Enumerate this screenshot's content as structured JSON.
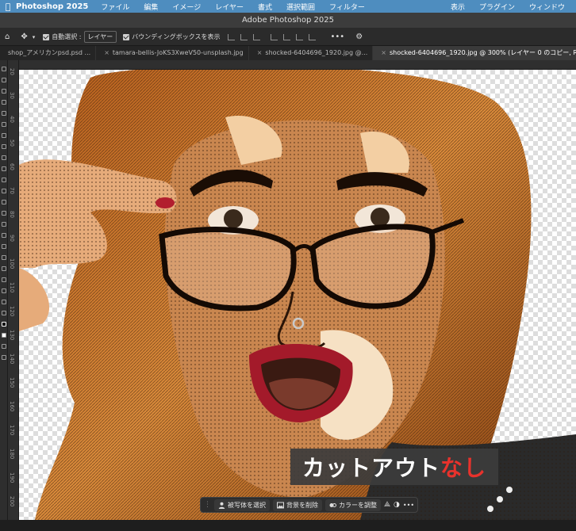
{
  "menubar": {
    "app": "Photoshop 2025",
    "items": [
      "ファイル",
      "編集",
      "イメージ",
      "レイヤー",
      "書式",
      "選択範囲",
      "フィルター"
    ],
    "right_items": [
      "表示",
      "プラグイン",
      "ウィンドウ"
    ]
  },
  "window": {
    "title": "Adobe Photoshop 2025"
  },
  "options": {
    "auto_select_label": "自動選択 :",
    "auto_select_value": "レイヤー",
    "bounding_box_label": "バウンディングボックスを表示"
  },
  "tabs": [
    {
      "label": "shop_アメリカンpsd.psd ..."
    },
    {
      "label": "tamara-bellis-JoKS3XweV50-unsplash.jpg"
    },
    {
      "label": "shocked-6404696_1920.jpg @..."
    },
    {
      "label": "shocked-6404696_1920.jpg @ 300% (レイヤー 0 のコピー, RG"
    }
  ],
  "ruler_marks": [
    "20",
    "30",
    "40",
    "50",
    "60",
    "70",
    "80",
    "90",
    "100",
    "110",
    "120",
    "130",
    "140",
    "150",
    "160",
    "170",
    "180",
    "190",
    "200"
  ],
  "context_bar": {
    "select_subject": "被写体を選択",
    "remove_bg": "背景を削除",
    "adjust_color": "カラーを調整",
    "more": "•••"
  },
  "caption": {
    "white": "カットアウト",
    "red": "なし"
  },
  "colors": {
    "menubar": "#4e8dbf",
    "caption_red": "#e8322c"
  }
}
